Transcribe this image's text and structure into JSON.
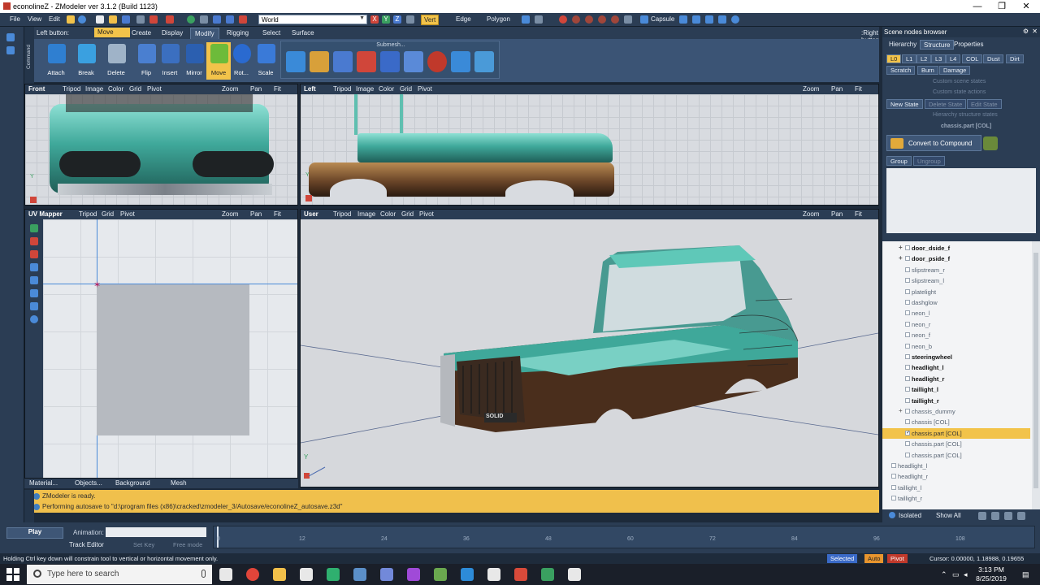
{
  "window": {
    "title": "econolineZ - ZModeler ver 3.1.2 (Build 1123)",
    "minimize": "—",
    "maximize": "❐",
    "close": "✕"
  },
  "menu": {
    "items": [
      "File",
      "View",
      "Edit"
    ],
    "world_select": "World",
    "modes": [
      {
        "label": "Vert",
        "active": true
      },
      {
        "label": "Edge",
        "active": false
      },
      {
        "label": "Polygon",
        "active": false
      }
    ],
    "capsule": "Capsule"
  },
  "left_strip": {
    "command_label": "Command"
  },
  "ribbon": {
    "left_button_label": "Left button:",
    "current_tool": "Move",
    "tabs": [
      {
        "label": "Create",
        "active": false
      },
      {
        "label": "Display",
        "active": false
      },
      {
        "label": "Modify",
        "active": true
      },
      {
        "label": "Rigging",
        "active": false
      },
      {
        "label": "Select",
        "active": false
      },
      {
        "label": "Surface",
        "active": false
      }
    ],
    "right_button_label": ":Right button",
    "tools": [
      {
        "label": "Attach",
        "icon": "attach-icon",
        "color": "#2f7fd1"
      },
      {
        "label": "Break",
        "icon": "break-icon",
        "color": "#3aa0e0"
      },
      {
        "label": "Delete",
        "icon": "trash-icon",
        "color": "#9fb3c8"
      },
      {
        "label": "Flip",
        "icon": "flip-icon",
        "color": "#4a7fd0"
      },
      {
        "label": "Insert",
        "icon": "insert-icon",
        "color": "#3b6fc0"
      },
      {
        "label": "Mirror",
        "icon": "mirror-icon",
        "color": "#2b5fb0"
      },
      {
        "label": "Move",
        "icon": "move-icon",
        "color": "#6dbb3a",
        "active": true
      },
      {
        "label": "Rot...",
        "icon": "rotate-icon",
        "color": "#2a6ad0"
      },
      {
        "label": "Scale",
        "icon": "scale-icon",
        "color": "#3a7ad8"
      }
    ],
    "submesh_label": "Submesh..."
  },
  "viewports": {
    "front": {
      "name": "Front",
      "items": [
        "Tripod",
        "Image",
        "Color",
        "Grid",
        "Pivot"
      ],
      "right": [
        "Zoom",
        "Pan",
        "Fit"
      ]
    },
    "left": {
      "name": "Left",
      "items": [
        "Tripod",
        "Image",
        "Color",
        "Grid",
        "Pivot"
      ],
      "right": [
        "Zoom",
        "Pan",
        "Fit"
      ]
    },
    "uv": {
      "name": "UV Mapper",
      "items": [
        "Tripod",
        "Grid",
        "Pivot"
      ],
      "right": [
        "Zoom",
        "Pan",
        "Fit"
      ]
    },
    "user": {
      "name": "User",
      "items": [
        "Tripod",
        "Image",
        "Color",
        "Grid",
        "Pivot"
      ],
      "right": [
        "Zoom",
        "Pan",
        "Fit"
      ]
    },
    "plate_text": "SOLID"
  },
  "bottom_tabs": [
    "Material...",
    "Objects...",
    "Background",
    "Mesh"
  ],
  "messages": [
    "ZModeler is ready.",
    "Performing autosave to \"d:\\program files (x86)\\cracked\\zmodeler_3/Autosave/econolineZ_autosave.z3d\""
  ],
  "scene_panel": {
    "title": "Scene nodes browser",
    "tabs": [
      {
        "label": "Hierarchy",
        "active": false
      },
      {
        "label": "Structure",
        "active": true
      },
      {
        "label": "Properties",
        "active": false
      }
    ],
    "lod_buttons": [
      {
        "label": "L0",
        "on": true
      },
      {
        "label": "L1",
        "on": false
      },
      {
        "label": "L2",
        "on": false
      },
      {
        "label": "L3",
        "on": false
      },
      {
        "label": "L4",
        "on": false
      },
      {
        "label": "COL",
        "on": false
      },
      {
        "label": "Dust",
        "on": false
      },
      {
        "label": "Dirt",
        "on": false
      }
    ],
    "row2": [
      "Scratch",
      "Burn",
      "Damage"
    ],
    "dim_state_1": "Custom scene states",
    "dim_state_2": "Custom state actions",
    "new_state": "New State",
    "delete_state": "Delete State",
    "edit_state": "Edit State",
    "dim_state_3": "Hierarchy structure states",
    "current_node": "chassis.part [COL]",
    "convert": "Convert to Compound",
    "group": "Group",
    "ungroup": "Ungroup",
    "tree": [
      {
        "label": "door_dside_f",
        "bold": true,
        "expander": "+"
      },
      {
        "label": "door_pside_f",
        "bold": true,
        "expander": "+"
      },
      {
        "label": "slipstream_r"
      },
      {
        "label": "slipstream_l"
      },
      {
        "label": "platelight"
      },
      {
        "label": "dashglow"
      },
      {
        "label": "neon_l"
      },
      {
        "label": "neon_r"
      },
      {
        "label": "neon_f"
      },
      {
        "label": "neon_b"
      },
      {
        "label": "steeringwheel",
        "bold": true
      },
      {
        "label": "headlight_l",
        "bold": true
      },
      {
        "label": "headlight_r",
        "bold": true
      },
      {
        "label": "taillight_l",
        "bold": true
      },
      {
        "label": "taillight_r",
        "bold": true
      },
      {
        "label": "chassis_dummy",
        "expander": "+"
      },
      {
        "label": "chassis [COL]"
      },
      {
        "label": "chassis.part [COL]",
        "selected": true
      },
      {
        "label": "chassis.part [COL]"
      },
      {
        "label": "chassis.part [COL]"
      },
      {
        "label": "headlight_l",
        "level0": true
      },
      {
        "label": "headlight_r",
        "level0": true
      },
      {
        "label": "taillight_l",
        "level0": true
      },
      {
        "label": "taillight_r",
        "level0": true
      }
    ],
    "footer": {
      "isolated": "Isolated",
      "show_all": "Show All"
    }
  },
  "timeline": {
    "play": "Play",
    "animation_label": "Animation:",
    "track_editor": "Track Editor",
    "set_key": "Set Key",
    "free_mode": "Free mode",
    "ticks": [
      "0",
      "12",
      "24",
      "36",
      "48",
      "60",
      "72",
      "84",
      "96",
      "108"
    ]
  },
  "status": {
    "hint": "Holding Ctrl key down will constrain tool to vertical or horizontal movement only.",
    "selected": "Selected",
    "auto": "Auto",
    "pivot": "Pivot",
    "cursor": "Cursor: 0.00000, 1.18988, 0.19655"
  },
  "taskbar": {
    "search_placeholder": "Type here to search",
    "time": "3:13 PM",
    "date": "8/25/2019",
    "apps": [
      {
        "icon": "task-view-icon",
        "color": "#e8e8e8"
      },
      {
        "icon": "chrome-icon",
        "color": "#e0453a"
      },
      {
        "icon": "folder-icon",
        "color": "#f2c04a"
      },
      {
        "icon": "mail-icon",
        "color": "#e8e8e8"
      },
      {
        "icon": "gamepad-icon",
        "color": "#2fb06f"
      },
      {
        "icon": "steam-icon",
        "color": "#5b8fc8"
      },
      {
        "icon": "discord-icon",
        "color": "#7289da"
      },
      {
        "icon": "feather-icon",
        "color": "#a04ad8"
      },
      {
        "icon": "minecraft-icon",
        "color": "#6aa84f"
      },
      {
        "icon": "app-icon",
        "color": "#2d8bd8"
      },
      {
        "icon": "rockstar-icon",
        "color": "#e8e8e8"
      },
      {
        "icon": "zmodeler-icon",
        "color": "#d84a3a"
      },
      {
        "icon": "notepad-icon",
        "color": "#3aa060"
      },
      {
        "icon": "calculator-icon",
        "color": "#e8e8e8"
      }
    ]
  }
}
